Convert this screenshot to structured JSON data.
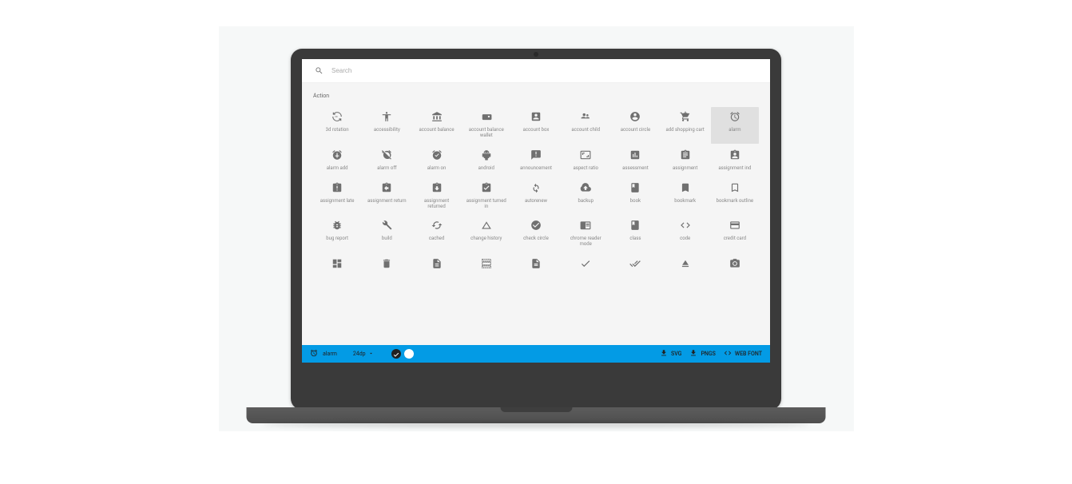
{
  "search": {
    "placeholder": "Search"
  },
  "category_label": "Action",
  "icons": {
    "row1": [
      {
        "name": "3d-rotation-icon",
        "label": "3d rotation"
      },
      {
        "name": "accessibility-icon",
        "label": "accessibility"
      },
      {
        "name": "account-balance-icon",
        "label": "account balance"
      },
      {
        "name": "account-balance-wallet-icon",
        "label": "account balance wallet"
      },
      {
        "name": "account-box-icon",
        "label": "account box"
      },
      {
        "name": "account-child-icon",
        "label": "account child"
      },
      {
        "name": "account-circle-icon",
        "label": "account circle"
      },
      {
        "name": "add-shopping-cart-icon",
        "label": "add shopping cart"
      },
      {
        "name": "alarm-icon",
        "label": "alarm",
        "selected": true
      }
    ],
    "row2": [
      {
        "name": "alarm-add-icon",
        "label": "alarm add"
      },
      {
        "name": "alarm-off-icon",
        "label": "alarm off"
      },
      {
        "name": "alarm-on-icon",
        "label": "alarm on"
      },
      {
        "name": "android-icon",
        "label": "android"
      },
      {
        "name": "announcement-icon",
        "label": "announcement"
      },
      {
        "name": "aspect-ratio-icon",
        "label": "aspect ratio"
      },
      {
        "name": "assessment-icon",
        "label": "assessment"
      },
      {
        "name": "assignment-icon",
        "label": "assignment"
      },
      {
        "name": "assignment-ind-icon",
        "label": "assignment ind"
      }
    ],
    "row3": [
      {
        "name": "assignment-late-icon",
        "label": "assignment late"
      },
      {
        "name": "assignment-return-icon",
        "label": "assignment return"
      },
      {
        "name": "assignment-returned-icon",
        "label": "assignment returned"
      },
      {
        "name": "assignment-turned-in-icon",
        "label": "assignment turned in"
      },
      {
        "name": "autorenew-icon",
        "label": "autorenew"
      },
      {
        "name": "backup-icon",
        "label": "backup"
      },
      {
        "name": "book-icon",
        "label": "book"
      },
      {
        "name": "bookmark-icon",
        "label": "bookmark"
      },
      {
        "name": "bookmark-outline-icon",
        "label": "bookmark outline"
      }
    ],
    "row4": [
      {
        "name": "bug-report-icon",
        "label": "bug report"
      },
      {
        "name": "build-icon",
        "label": "build"
      },
      {
        "name": "cached-icon",
        "label": "cached"
      },
      {
        "name": "change-history-icon",
        "label": "change history"
      },
      {
        "name": "check-circle-icon",
        "label": "check circle"
      },
      {
        "name": "chrome-reader-mode-icon",
        "label": "chrome reader mode"
      },
      {
        "name": "class-icon",
        "label": "class"
      },
      {
        "name": "code-icon",
        "label": "code"
      },
      {
        "name": "credit-card-icon",
        "label": "credit card"
      }
    ],
    "row5": [
      {
        "name": "dashboard-icon",
        "label": ""
      },
      {
        "name": "delete-icon",
        "label": ""
      },
      {
        "name": "description-icon",
        "label": ""
      },
      {
        "name": "dns-icon",
        "label": ""
      },
      {
        "name": "document-icon",
        "label": ""
      },
      {
        "name": "done-icon",
        "label": ""
      },
      {
        "name": "done-all-icon",
        "label": ""
      },
      {
        "name": "eject-icon",
        "label": ""
      },
      {
        "name": "camera-icon",
        "label": ""
      }
    ]
  },
  "footer": {
    "selected_icon_label": "alarm",
    "size_label": "24dp",
    "download_svg": "SVG",
    "download_png": "PNGS",
    "download_webfont": "WEB FONT"
  },
  "colors": {
    "accent": "#039be5"
  }
}
